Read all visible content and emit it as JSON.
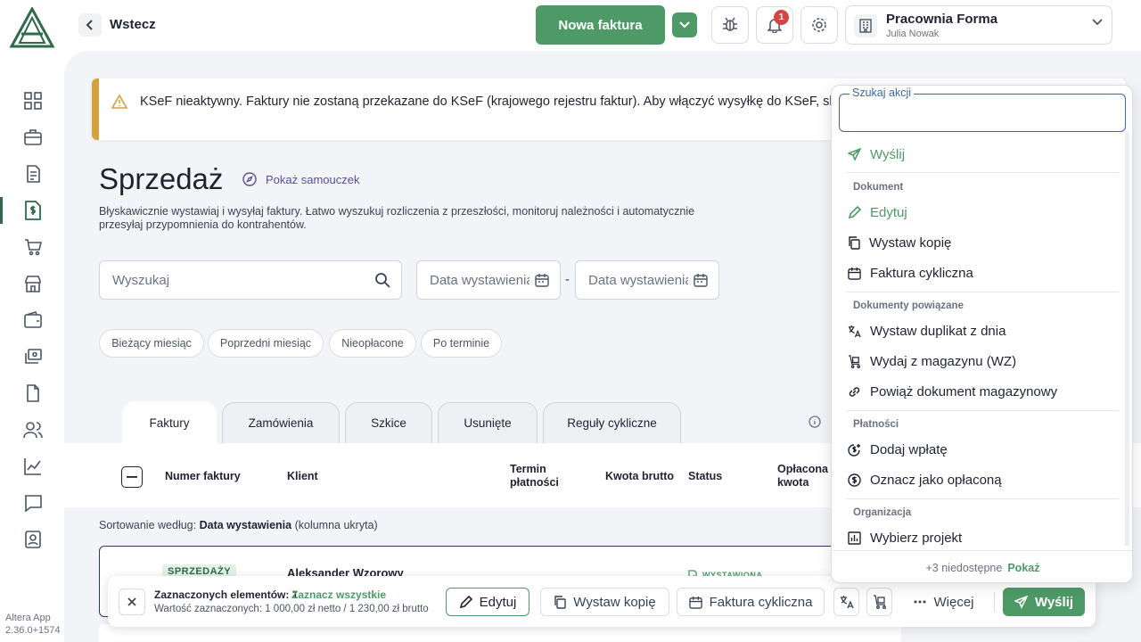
{
  "nav": {
    "back_label": "Wstecz",
    "new_invoice_label": "Nowa faktura",
    "notification_count": "1"
  },
  "company": {
    "name": "Pracownia Forma",
    "user": "Julia Nowak"
  },
  "app": {
    "name": "Altera App",
    "version": "2.36.0+1574"
  },
  "banner": {
    "text": "KSeF nieaktywny. Faktury nie zostaną przekazane do KSeF (krajowego rejestru faktur). Aby włączyć wysyłkę do KSeF, skonfiguruj integrację z KSeF w ustawieniach firmy."
  },
  "page": {
    "title": "Sprzedaż",
    "tutorial_label": "Pokaż samouczek",
    "description": "Błyskawicznie wystawiaj i wysyłaj faktury. Łatwo wyszukuj rozliczenia z przeszłości, monitoruj należności i automatycznie przesyłaj przypomnienia do kontrahentów."
  },
  "filters": {
    "search_placeholder": "Wyszukaj",
    "date_from_placeholder": "Data wystawienia od",
    "date_to_placeholder": "Data wystawienia do",
    "date_separator": "-",
    "chips": [
      "Bieżący miesiąc",
      "Poprzedni miesiąc",
      "Nieopłacone",
      "Po terminie"
    ]
  },
  "tabs": [
    "Faktury",
    "Zamówienia",
    "Szkice",
    "Usunięte",
    "Reguły cykliczne"
  ],
  "table": {
    "headers": {
      "number": "Numer faktury",
      "client": "Klient",
      "due_1": "Termin",
      "due_2": "płatności",
      "gross": "Kwota brutto",
      "status": "Status",
      "paid_1": "Opłacona",
      "paid_2": "kwota"
    },
    "sort_prefix": "Sortowanie według:",
    "sort_field": "Data wystawienia",
    "sort_suffix": "(kolumna ukryta)",
    "rows": [
      {
        "type": "SPRZEDAŻY",
        "client": "Aleksander Wzorowy",
        "status": "WYSTAWIONA"
      }
    ]
  },
  "selection": {
    "count_label": "Zaznaczonych elementów: 1",
    "select_all": "Zaznacz wszystkie",
    "value_label": "Wartość zaznaczonych: 1 000,00 zł netto / 1 230,00 zł brutto",
    "edit": "Edytuj",
    "copy": "Wystaw kopię",
    "recurring": "Faktura cykliczna",
    "more": "Więcej",
    "send": "Wyślij"
  },
  "actions": {
    "search_label": "Szukaj akcji",
    "send": "Wyślij",
    "section_document": "Dokument",
    "edit": "Edytuj",
    "copy": "Wystaw kopię",
    "recurring": "Faktura cykliczna",
    "section_related": "Dokumenty powiązane",
    "duplicate": "Wystaw duplikat z dnia",
    "warehouse_out": "Wydaj z magazynu (WZ)",
    "link_warehouse": "Powiąż dokument magazynowy",
    "section_payments": "Płatności",
    "add_payment": "Dodaj wpłatę",
    "mark_paid": "Oznacz jako opłaconą",
    "section_org": "Organizacja",
    "choose_project": "Wybierz projekt",
    "unavailable": "+3 niedostępne",
    "show": "Pokaż"
  },
  "colors": {
    "brand_green": "#4e9a67",
    "warning": "#d7a13a",
    "badge_red": "#d64545",
    "focus_blue": "#3a67b0"
  }
}
